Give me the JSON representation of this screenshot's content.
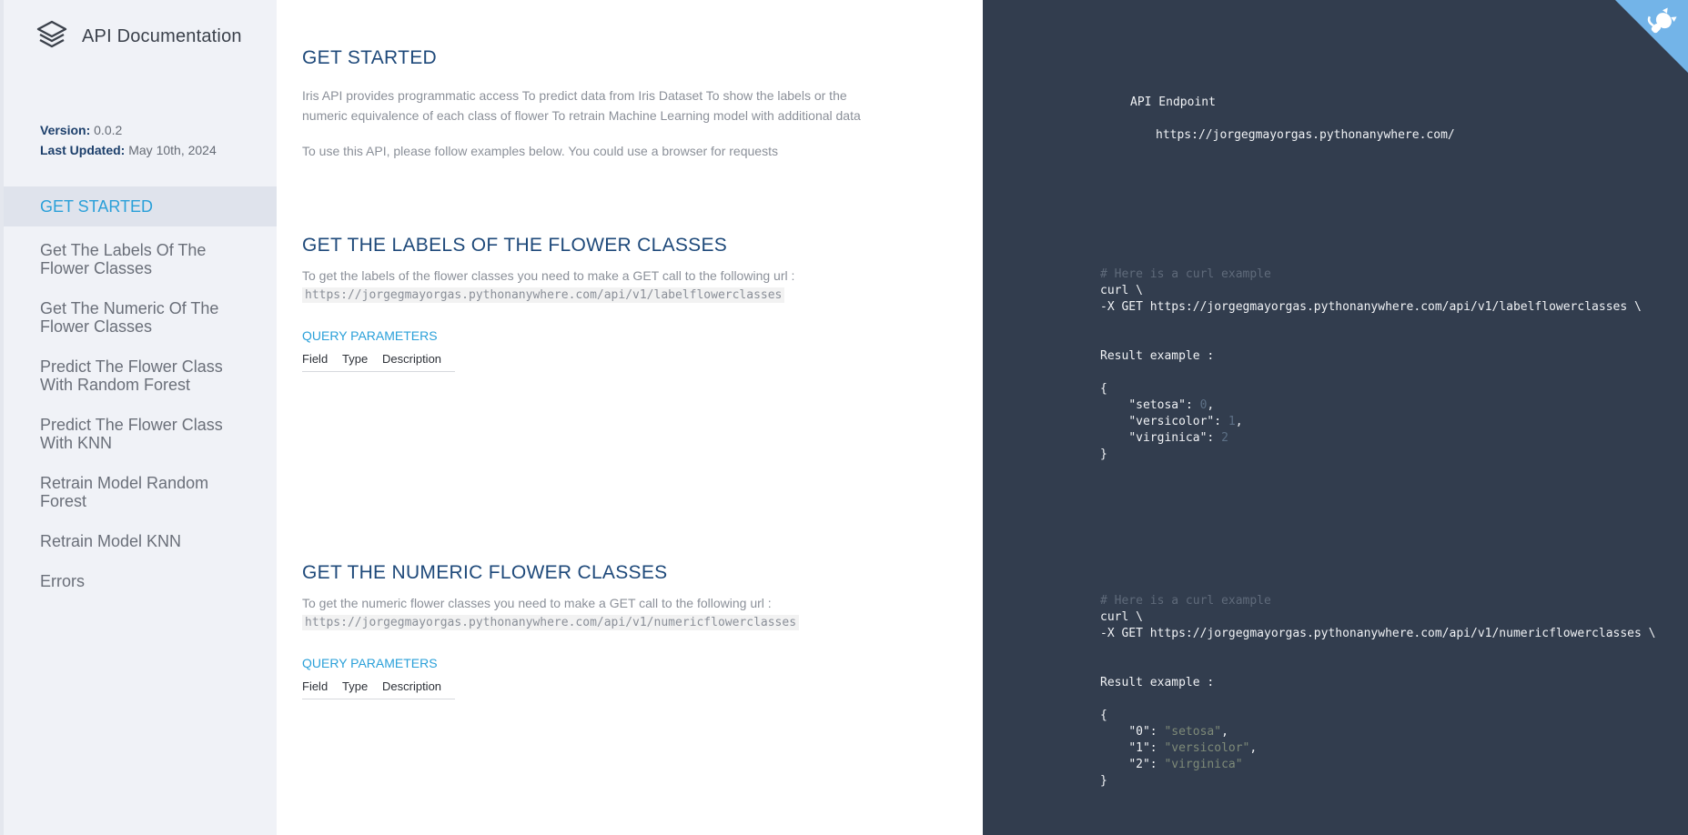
{
  "sidebar": {
    "brand_title": "API Documentation",
    "version_label": "Version:",
    "version_value": "0.0.2",
    "updated_label": "Last Updated:",
    "updated_value": "May 10th, 2024",
    "items": [
      {
        "label": "GET STARTED",
        "active": true
      },
      {
        "label": "Get The Labels Of The Flower Classes"
      },
      {
        "label": "Get The Numeric Of The Flower Classes"
      },
      {
        "label": "Predict The Flower Class With Random Forest"
      },
      {
        "label": "Predict The Flower Class With KNN"
      },
      {
        "label": "Retrain Model Random Forest"
      },
      {
        "label": "Retrain Model KNN"
      },
      {
        "label": "Errors"
      }
    ]
  },
  "main": {
    "get_started": {
      "title": "GET STARTED",
      "para1": "Iris API provides programmatic access To predict data from Iris Dataset To show the labels or the numeric equivalence of each class of flower To retrain Machine Learning model with additional data",
      "para2": "To use this API, please follow examples below. You could use a browser for requests"
    },
    "labels": {
      "title": "GET THE LABELS OF THE FLOWER CLASSES",
      "desc": "To get the labels of the flower classes you need to make a GET call to the following url :",
      "url": "https://jorgegmayorgas.pythonanywhere.com/api/v1/labelflowerclasses",
      "qp_title": "QUERY PARAMETERS",
      "col_field": "Field",
      "col_type": "Type",
      "col_desc": "Description"
    },
    "numeric": {
      "title": "GET THE NUMERIC FLOWER CLASSES",
      "desc": "To get the numeric flower classes you need to make a GET call to the following url :",
      "url": "https://jorgegmayorgas.pythonanywhere.com/api/v1/numericflowerclasses",
      "qp_title": "QUERY PARAMETERS",
      "col_field": "Field",
      "col_type": "Type",
      "col_desc": "Description"
    }
  },
  "code": {
    "endpoint_label": "API Endpoint",
    "endpoint_url": "https://jorgegmayorgas.pythonanywhere.com/",
    "labels": {
      "comment": "# Here is a curl example",
      "curl": "curl \\",
      "get": "-X GET https://jorgegmayorgas.pythonanywhere.com/api/v1/labelflowerclasses \\",
      "result": "Result example :",
      "open": "{",
      "k1": "\"setosa\"",
      "v1": "0",
      "k2": "\"versicolor\"",
      "v2": "1",
      "k3": "\"virginica\"",
      "v3": "2",
      "close": "}"
    },
    "numeric": {
      "comment": "# Here is a curl example",
      "curl": "curl \\",
      "get": "-X GET https://jorgegmayorgas.pythonanywhere.com/api/v1/numericflowerclasses \\",
      "result": "Result example :",
      "open": "{",
      "k1": "\"0\"",
      "v1": "\"setosa\"",
      "k2": "\"1\"",
      "v2": "\"versicolor\"",
      "k3": "\"2\"",
      "v3": "\"virginica\"",
      "close": "}"
    }
  },
  "colors": {
    "accent": "#2aa0d9",
    "heading": "#1e497a",
    "code_bg": "#323d4e",
    "sidebar_bg": "#f0f2f7"
  },
  "icons": {
    "brand": "layers-icon",
    "corner": "github-octocat-icon"
  }
}
